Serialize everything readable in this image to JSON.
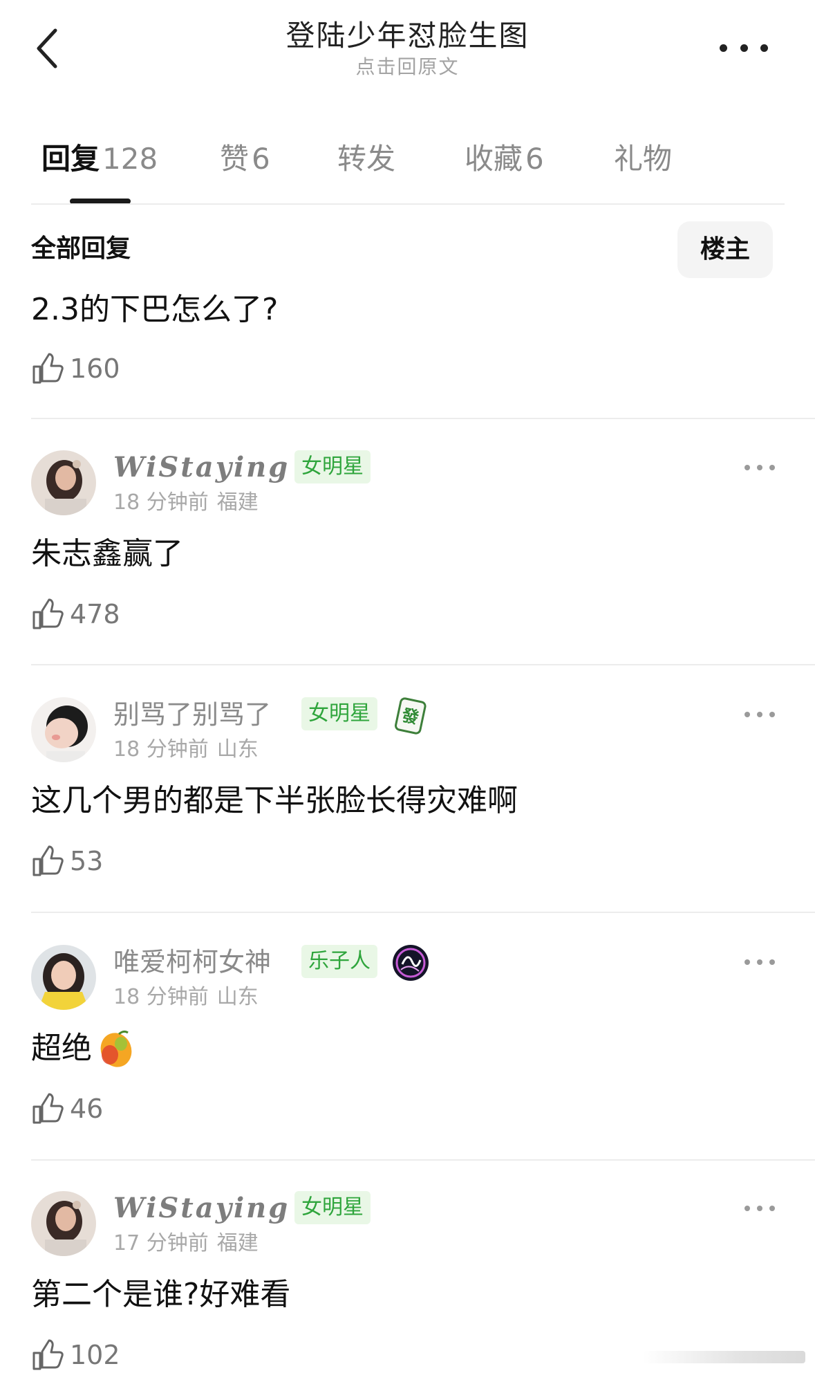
{
  "nav": {
    "title": "登陆少年怼脸生图",
    "subtitle": "点击回原文"
  },
  "tabs": [
    {
      "label": "回复",
      "count": "128"
    },
    {
      "label": "赞",
      "count": "6"
    },
    {
      "label": "转发",
      "count": ""
    },
    {
      "label": "收藏",
      "count": "6"
    },
    {
      "label": "礼物",
      "count": ""
    }
  ],
  "filter": {
    "label": "全部回复",
    "op_button": "楼主"
  },
  "question": {
    "text": "2.3的下巴怎么了?",
    "likes": "160"
  },
  "comments": [
    {
      "name": "WiStaying",
      "badge": "女明星",
      "time": "18 分钟前",
      "location": "福建",
      "text": "朱志鑫赢了",
      "likes": "478"
    },
    {
      "name": "别骂了别骂了",
      "badge": "女明星",
      "decoration_icon": "mahjong-fa-icon",
      "decoration_text": "發",
      "time": "18 分钟前",
      "location": "山东",
      "text": "这几个男的都是下半张脸长得灾难啊",
      "likes": "53"
    },
    {
      "name": "唯爱柯柯女神",
      "badge": "乐子人",
      "decoration_icon": "medal-icon",
      "time": "18 分钟前",
      "location": "山东",
      "text": "超绝",
      "emoji_icon": "mango-emoji",
      "likes": "46"
    },
    {
      "name": "WiStaying",
      "badge": "女明星",
      "time": "17 分钟前",
      "location": "福建",
      "text": "第二个是谁?好难看",
      "likes": "102"
    }
  ],
  "colors": {
    "badge_bg": "#e9f7e6",
    "badge_text": "#2fa53c",
    "divider": "#ececec",
    "muted": "#8a8a8a"
  }
}
